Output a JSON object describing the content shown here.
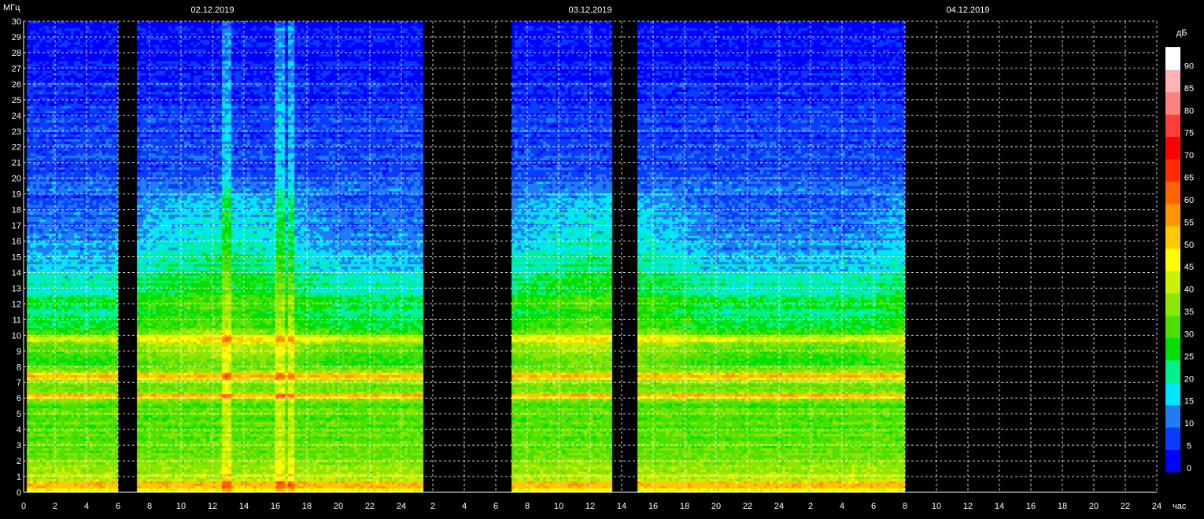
{
  "chart_data": {
    "type": "heatmap",
    "y_unit": "МГц",
    "x_unit": "час",
    "colorbar_unit": "дБ",
    "ylim": [
      0,
      30
    ],
    "y_ticks": [
      0,
      1,
      2,
      3,
      4,
      5,
      6,
      7,
      8,
      9,
      10,
      11,
      12,
      13,
      14,
      15,
      16,
      17,
      18,
      19,
      20,
      21,
      22,
      23,
      24,
      25,
      26,
      27,
      28,
      29,
      30
    ],
    "x_tick_labels": [
      "0",
      "2",
      "4",
      "6",
      "8",
      "10",
      "12",
      "14",
      "16",
      "18",
      "20",
      "22",
      "24",
      "2",
      "4",
      "6",
      "8",
      "10",
      "12",
      "14",
      "16",
      "18",
      "20",
      "22",
      "24",
      "2",
      "4",
      "6",
      "8",
      "10",
      "12",
      "14",
      "16",
      "18",
      "20",
      "22",
      "24"
    ],
    "days": [
      {
        "label": "02.12.2019",
        "start_hour": 0
      },
      {
        "label": "03.12.2019",
        "start_hour": 24
      },
      {
        "label": "04.12.2019",
        "start_hour": 48
      }
    ],
    "x_range_hours": [
      0,
      72
    ],
    "data_segments_hours": [
      [
        0.2,
        6.0
      ],
      [
        7.2,
        25.4
      ],
      [
        31.0,
        37.4
      ],
      [
        39.0,
        56.0
      ]
    ],
    "colorbar": {
      "ticks": [
        0,
        5,
        10,
        15,
        20,
        25,
        30,
        35,
        40,
        45,
        50,
        55,
        60,
        65,
        70,
        75,
        80,
        85,
        90
      ],
      "colors": [
        "#0000ff",
        "#0a3cff",
        "#1f7cf5",
        "#00e6ff",
        "#00f08c",
        "#00e000",
        "#4ee000",
        "#8ce600",
        "#c8f000",
        "#ffff00",
        "#ffc800",
        "#ff9600",
        "#ff6400",
        "#ff2d00",
        "#ff0000",
        "#ff3c3c",
        "#ff8282",
        "#ffb4b4",
        "#ffffff"
      ]
    },
    "profile_db_by_mhz": [
      [
        0,
        46
      ],
      [
        0.8,
        44
      ],
      [
        1.5,
        38
      ],
      [
        2.5,
        34
      ],
      [
        4,
        33
      ],
      [
        5.5,
        33
      ],
      [
        6.2,
        45
      ],
      [
        6.6,
        33
      ],
      [
        7.4,
        44
      ],
      [
        8,
        31
      ],
      [
        9.7,
        38
      ],
      [
        10.5,
        27
      ],
      [
        12,
        26
      ],
      [
        13.5,
        22
      ],
      [
        15,
        17
      ],
      [
        16,
        14
      ],
      [
        18,
        12
      ],
      [
        20,
        10
      ],
      [
        22,
        8
      ],
      [
        25,
        6
      ],
      [
        28,
        3
      ],
      [
        30,
        2
      ]
    ],
    "strong_bands_mhz": [
      0.5,
      6.1,
      7.4,
      9.8
    ],
    "interference_hours": [
      12.8,
      16.2,
      16.9
    ]
  }
}
